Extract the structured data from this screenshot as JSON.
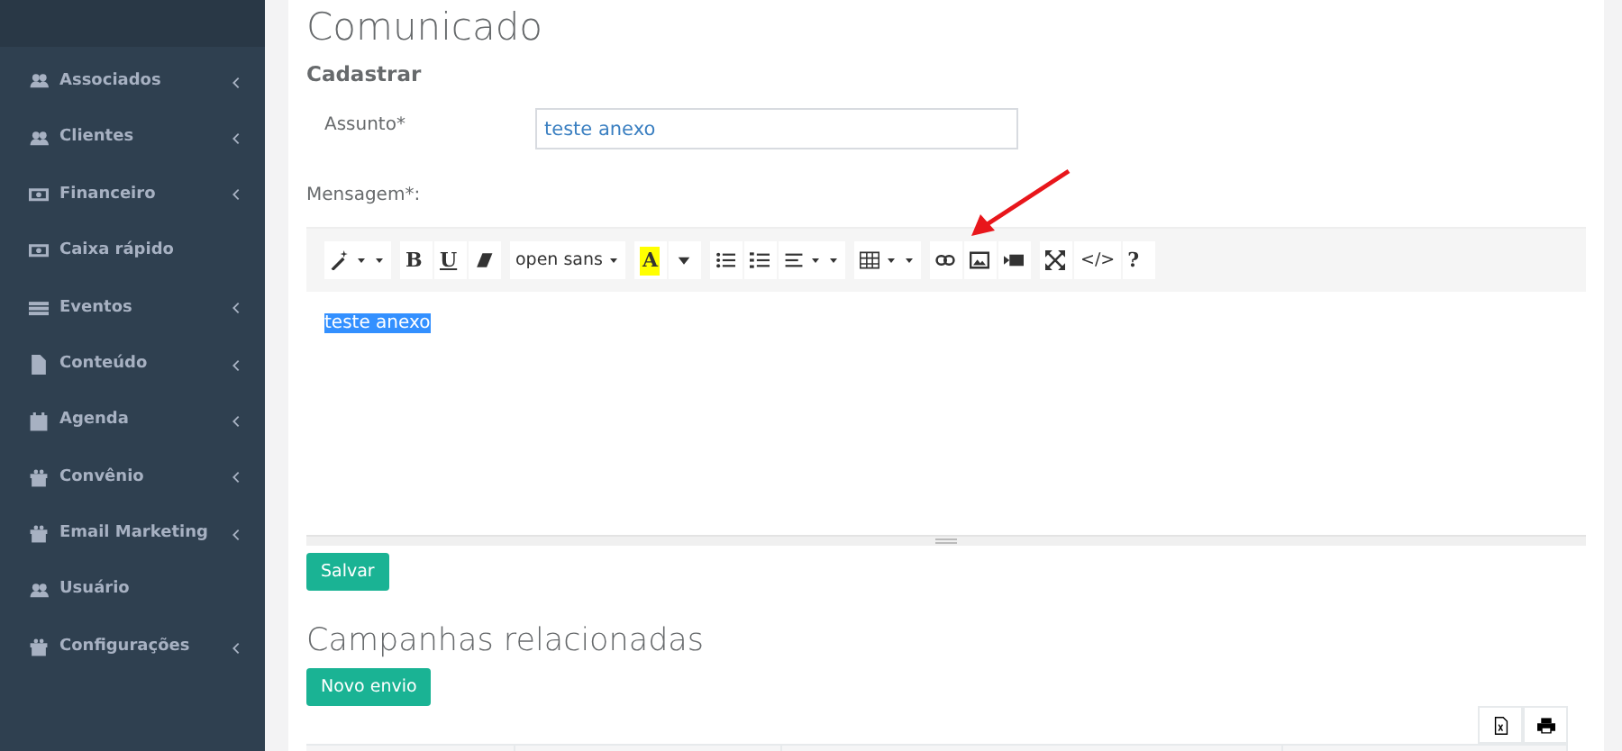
{
  "sidebar": {
    "items": [
      {
        "label": "Associados",
        "kind": "users",
        "expandable": true
      },
      {
        "label": "Clientes",
        "kind": "users",
        "expandable": true
      },
      {
        "label": "Financeiro",
        "kind": "money",
        "expandable": true
      },
      {
        "label": "Caixa rápido",
        "kind": "money",
        "expandable": false
      },
      {
        "label": "Eventos",
        "kind": "list",
        "expandable": true
      },
      {
        "label": "Conteúdo",
        "kind": "file",
        "expandable": true
      },
      {
        "label": "Agenda",
        "kind": "calendar",
        "expandable": true
      },
      {
        "label": "Convênio",
        "kind": "gift",
        "expandable": true
      },
      {
        "label": "Email Marketing",
        "kind": "gift",
        "expandable": true
      },
      {
        "label": "Usuário",
        "kind": "users",
        "expandable": false
      },
      {
        "label": "Configurações",
        "kind": "gift",
        "expandable": true
      }
    ]
  },
  "page_title": "Comunicado",
  "form": {
    "subtitle": "Cadastrar",
    "subject": {
      "label": "Assunto*",
      "value": "teste anexo"
    },
    "message": {
      "label": "Mensagem*:",
      "content": "teste anexo",
      "content_selected": true
    },
    "toolbar": [
      [
        {
          "kind": "magic",
          "dropdown": true
        }
      ],
      [
        {
          "kind": "bold",
          "text": "B"
        },
        {
          "kind": "underline",
          "text": "U"
        },
        {
          "kind": "eraser"
        }
      ],
      [
        {
          "kind": "font",
          "text": "open sans",
          "dropdown": true
        }
      ],
      [
        {
          "kind": "color",
          "text": "A"
        },
        {
          "kind": "caret"
        }
      ],
      [
        {
          "kind": "ul"
        },
        {
          "kind": "ol"
        },
        {
          "kind": "align",
          "dropdown": true
        }
      ],
      [
        {
          "kind": "table",
          "dropdown": true
        }
      ],
      [
        {
          "kind": "link"
        },
        {
          "kind": "picture"
        },
        {
          "kind": "video"
        }
      ],
      [
        {
          "kind": "fullscreen"
        },
        {
          "kind": "code",
          "text": "</>"
        },
        {
          "kind": "help",
          "text": "?"
        }
      ]
    ],
    "save_button": "Salvar"
  },
  "campaigns": {
    "title": "Campanhas relacionadas",
    "new_button": "Novo envio",
    "tools": [
      {
        "kind": "excel"
      },
      {
        "kind": "print"
      }
    ]
  }
}
